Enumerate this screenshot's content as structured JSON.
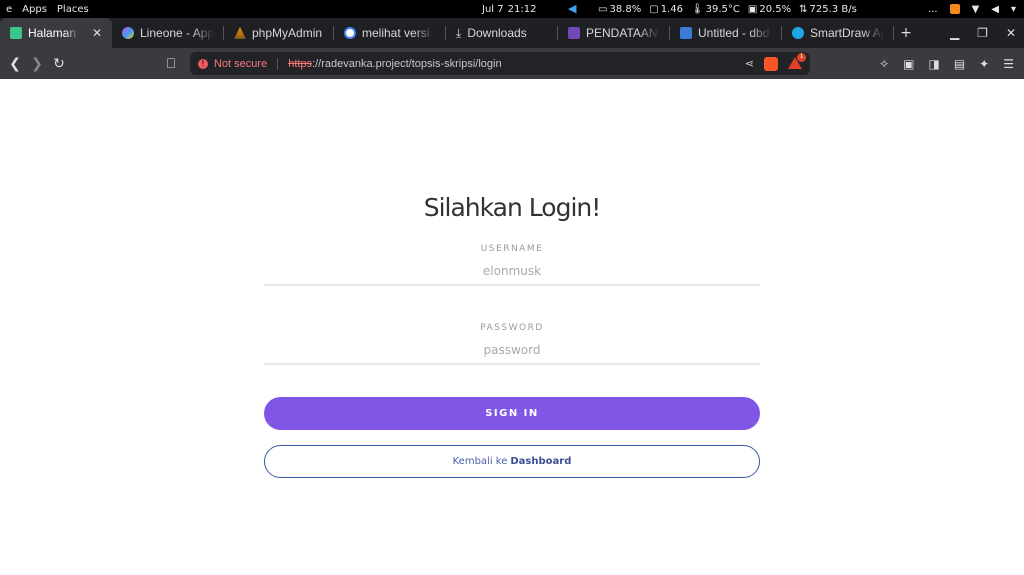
{
  "sysbar": {
    "left": [
      "e",
      "Apps",
      "Places"
    ],
    "date": "Jul 7",
    "time": "21:12",
    "stats": [
      "38.8%",
      "1.46",
      "39.5°C",
      "20.5%",
      "725.3 B/s"
    ],
    "dots": "..."
  },
  "tabs": [
    {
      "label": "Halaman L",
      "color": "#3cc68a",
      "active": true
    },
    {
      "label": "Lineone - App",
      "color": "#d64df0"
    },
    {
      "label": "phpMyAdmin",
      "color": "#f29100"
    },
    {
      "label": "melihat versi :",
      "color": "#ffffff"
    },
    {
      "label": "Downloads",
      "color": ""
    },
    {
      "label": "PENDATAAN T",
      "color": "#7248b9"
    },
    {
      "label": "Untitled - dbd",
      "color": "#3a7bd5"
    },
    {
      "label": "SmartDraw Ap",
      "color": "#1ea7e6"
    }
  ],
  "newtab": "+",
  "address": {
    "not_secure": "Not secure",
    "protocol": "https",
    "rest": "://radevanka.project/topsis-skripsi/login",
    "badge_count": "1"
  },
  "login": {
    "title": "Silahkan Login!",
    "username_label": "USERNAME",
    "username_placeholder": "elonmusk",
    "password_label": "PASSWORD",
    "password_placeholder": "password",
    "signin": "SIGN IN",
    "back_prefix": "Kembali ke",
    "back_link": "Dashboard"
  },
  "colors": {
    "accent": "#7f56e6",
    "outline": "#3a57a6"
  }
}
